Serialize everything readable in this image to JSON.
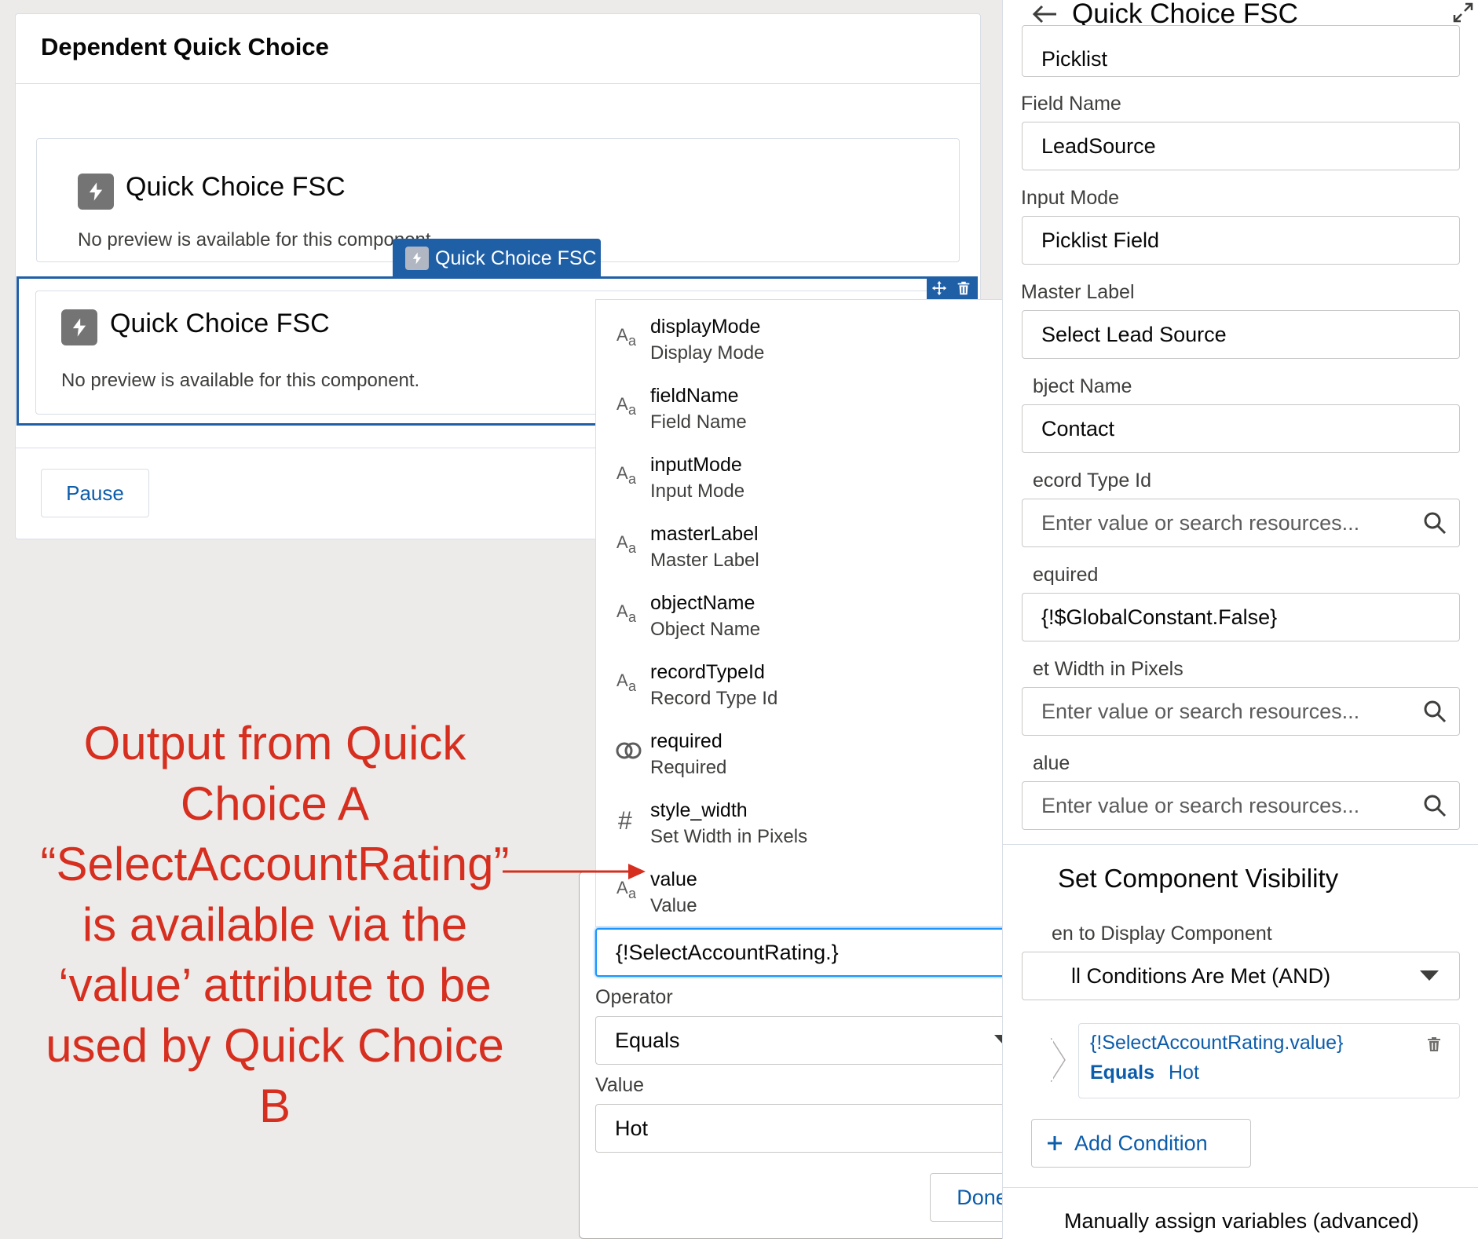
{
  "screen": {
    "title": "Dependent Quick Choice",
    "component_a": {
      "title": "Quick Choice FSC",
      "preview": "No preview is available for this component."
    },
    "component_b": {
      "title": "Quick Choice FSC",
      "preview": "No preview is available for this component."
    },
    "selected_tab_label": "Quick Choice FSC",
    "pause_label": "Pause"
  },
  "annotation": {
    "lines": [
      "Output from Quick",
      "Choice A",
      "“SelectAccountRating”",
      "is available via the",
      "‘value’ attribute to be",
      "used by Quick Choice",
      "B"
    ]
  },
  "resource_dropdown": {
    "items": [
      {
        "icon": "text-icon",
        "name": "displayMode",
        "label": "Display Mode"
      },
      {
        "icon": "text-icon",
        "name": "fieldName",
        "label": "Field Name"
      },
      {
        "icon": "text-icon",
        "name": "inputMode",
        "label": "Input Mode"
      },
      {
        "icon": "text-icon",
        "name": "masterLabel",
        "label": "Master Label"
      },
      {
        "icon": "text-icon",
        "name": "objectName",
        "label": "Object Name"
      },
      {
        "icon": "text-icon",
        "name": "recordTypeId",
        "label": "Record Type Id"
      },
      {
        "icon": "boolean-icon",
        "name": "required",
        "label": "Required"
      },
      {
        "icon": "number-icon",
        "name": "style_width",
        "label": "Set Width in Pixels"
      },
      {
        "icon": "text-icon",
        "name": "value",
        "label": "Value"
      }
    ]
  },
  "condition_editor": {
    "resource_value": "{!SelectAccountRating.}",
    "operator_label": "Operator",
    "operator_value": "Equals",
    "value_label": "Value",
    "value_value": "Hot",
    "done_label": "Done"
  },
  "panel": {
    "title": "Quick Choice FSC",
    "top_field_value": "Picklist",
    "fields": {
      "field_name_label": "Field Name",
      "field_name_value": "LeadSource",
      "input_mode_label": "Input Mode",
      "input_mode_value": "Picklist Field",
      "master_label_label": "Master Label",
      "master_label_value": "Select Lead Source",
      "object_name_label": "bject Name",
      "object_name_value": "Contact",
      "record_type_label": "ecord Type Id",
      "record_type_placeholder": "Enter value or search resources...",
      "required_label": "equired",
      "required_value": "{!$GlobalConstant.False}",
      "width_label": "et Width in Pixels",
      "width_placeholder": "Enter value or search resources...",
      "value_label": "alue",
      "value_placeholder": "Enter value or search resources..."
    },
    "visibility": {
      "title": "Set Component Visibility",
      "when_label": "en to Display Component",
      "when_value": "ll Conditions Are Met (AND)",
      "condition_resource": "{!SelectAccountRating.value}",
      "condition_operator": "Equals",
      "condition_value": "Hot",
      "add_condition_label": "Add Condition"
    },
    "manual_assign_label": "Manually assign variables (advanced)"
  },
  "colors": {
    "brand_blue": "#1f5fa6",
    "link_blue": "#0b5cab",
    "annotation_red": "#d62f1f",
    "focus_blue": "#1b96ff"
  }
}
